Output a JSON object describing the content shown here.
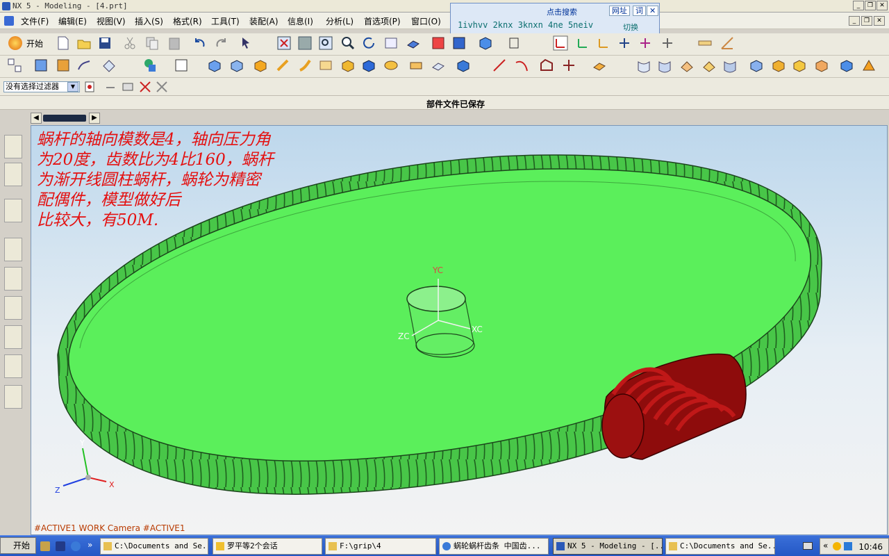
{
  "window": {
    "title": "NX 5 - Modeling - [4.prt]"
  },
  "menu": [
    "文件(F)",
    "编辑(E)",
    "视图(V)",
    "插入(S)",
    "格式(R)",
    "工具(T)",
    "装配(A)",
    "信息(I)",
    "分析(L)",
    "首选项(P)",
    "窗口(O)"
  ],
  "search_popup": {
    "title": "点击搜索",
    "btn_web": "网址",
    "btn_word": "词",
    "close": "✕",
    "links": "1ivhvv 2knx 3knxn 4ne 5neiv",
    "switch": "切换"
  },
  "toolbar": {
    "start_label": "开始"
  },
  "selection_filter": {
    "value": "没有选择过滤器"
  },
  "status": {
    "message": "部件文件已保存"
  },
  "viewport": {
    "note": "蜗杆的轴向模数是4，轴向压力角\n为20度，齿数比为4比160，蜗杆\n为渐开线圆柱蜗杆，蜗轮为精密\n配偶件，模型做好后\n比较大，有50M.",
    "camera_label": "#ACTIVE1 WORK Camera #ACTIVE1",
    "wcs": {
      "yc": "YC",
      "xc": "XC",
      "zc": "ZC"
    },
    "triad": {
      "x": "X",
      "y": "Y",
      "z": "Z"
    },
    "colors": {
      "wheel": "#55ee55",
      "worm": "#a30d0d"
    }
  },
  "taskbar": {
    "start": "开始",
    "tasks": [
      {
        "label": "C:\\Documents and Se..."
      },
      {
        "label": "罗平等2个会话"
      },
      {
        "label": "F:\\grip\\4"
      },
      {
        "label": "蜗轮蜗杆齿条 中国齿..."
      },
      {
        "label": "NX 5 - Modeling - [..."
      },
      {
        "label": "C:\\Documents and Se..."
      }
    ],
    "clock": "10:46"
  }
}
